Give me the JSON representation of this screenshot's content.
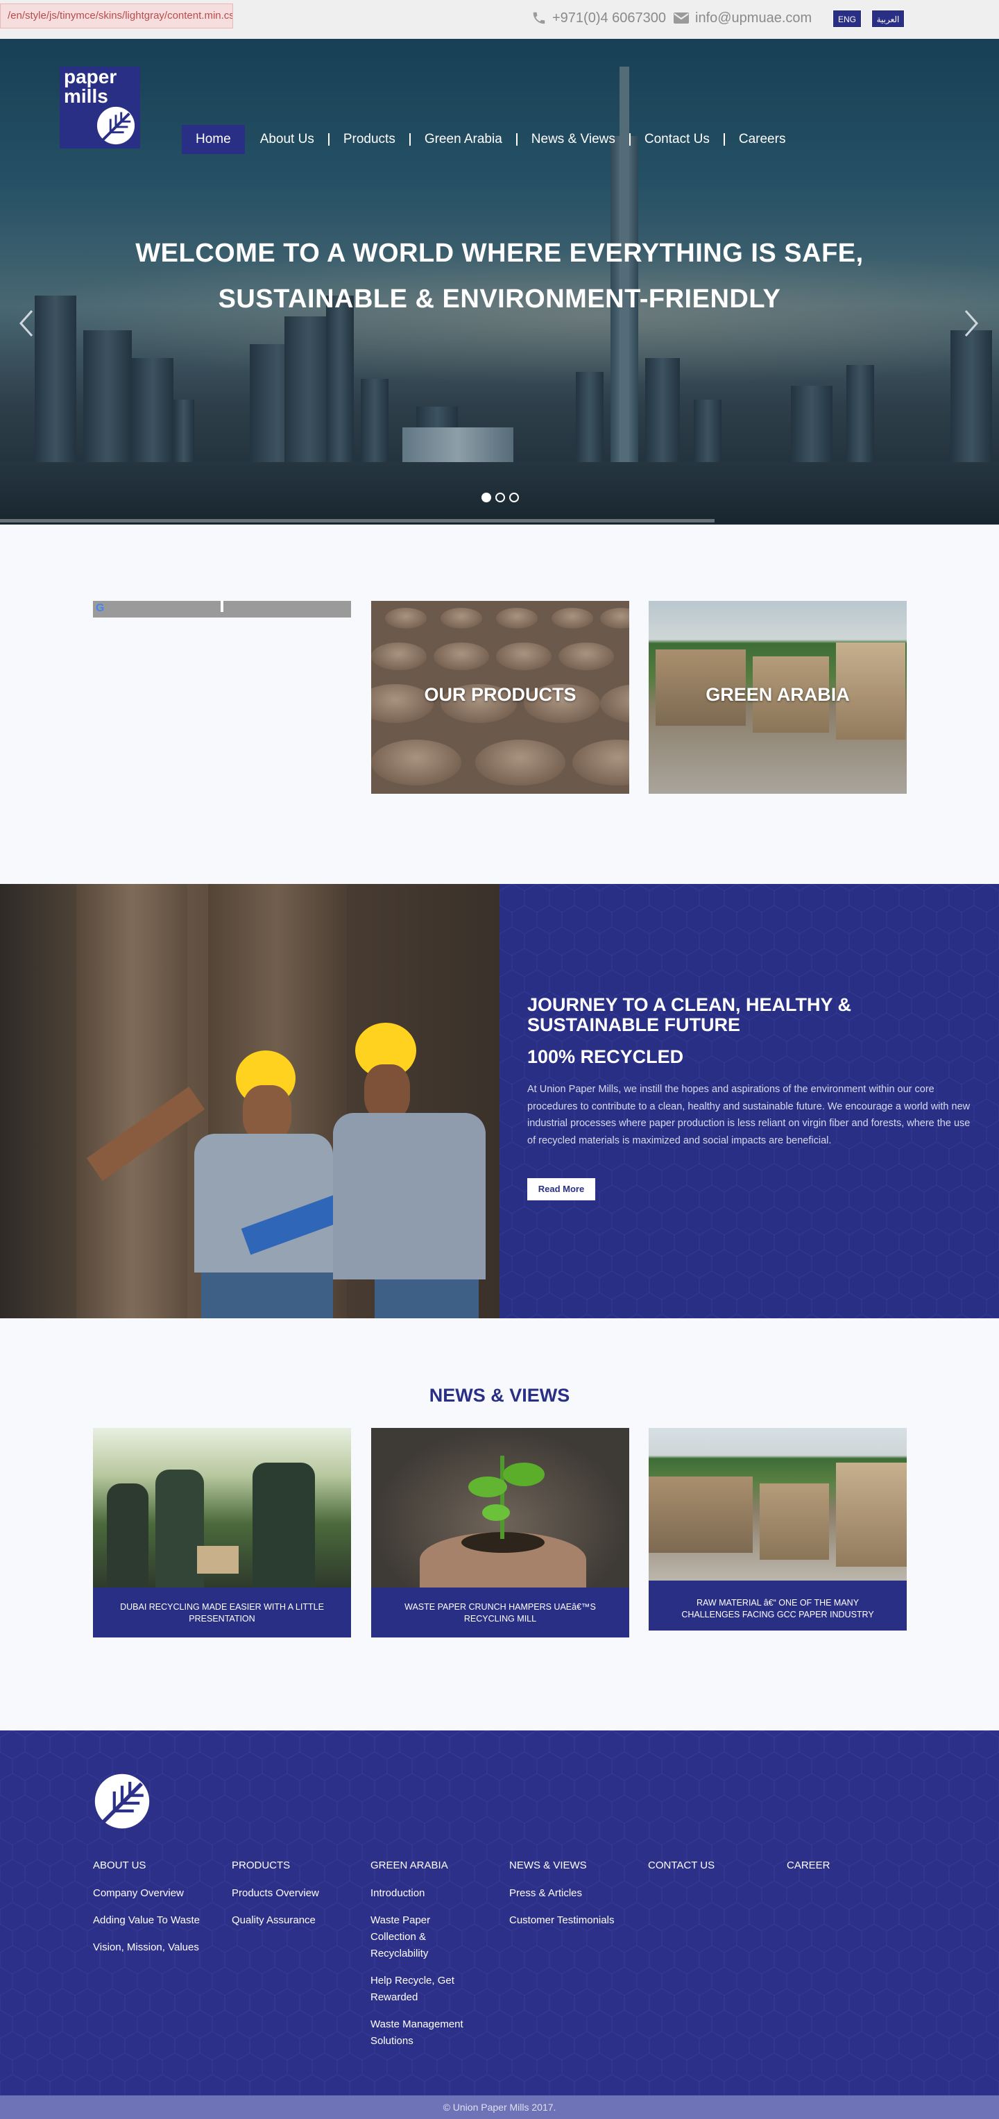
{
  "topbar": {
    "error_note": "/en/style/js/tinymce/skins/lightgray/content.min.css",
    "error_close": "×",
    "phone": "+971(0)4 6067300",
    "email": "info@upmuae.com",
    "lang_en": "ENG",
    "lang_ar": "العربية"
  },
  "logo": {
    "line1": "paper",
    "line2": "mills"
  },
  "nav": {
    "items": [
      {
        "label": "Home",
        "active": true
      },
      {
        "label": "About Us"
      },
      {
        "label": "Products"
      },
      {
        "label": "Green Arabia"
      },
      {
        "label": "News & Views"
      },
      {
        "label": "Contact Us"
      },
      {
        "label": "Careers"
      }
    ]
  },
  "hero": {
    "title_line1": "WELCOME TO A WORLD WHERE EVERYTHING IS SAFE,",
    "title_line2": "SUSTAINABLE & ENVIRONMENT-FRIENDLY",
    "slides_total": 3,
    "slide_active": 1
  },
  "tiles": {
    "google_mark": "G",
    "products_label": "OUR PRODUCTS",
    "green_label": "GREEN ARABIA"
  },
  "journey": {
    "title": "JOURNEY TO A CLEAN, HEALTHY & SUSTAINABLE FUTURE",
    "subtitle": "100% RECYCLED",
    "body": "At Union Paper Mills, we instill the hopes and aspirations of the environment within our core procedures to contribute to a clean, healthy and sustainable future. We encourage a world with new industrial processes where paper production is less reliant on virgin fiber and forests, where the use of recycled materials is maximized and social impacts are beneficial.",
    "button": "Read More"
  },
  "news": {
    "heading": "NEWS & VIEWS",
    "items": [
      {
        "caption": "DUBAI RECYCLING MADE EASIER WITH A LITTLE PRESENTATION"
      },
      {
        "caption": "WASTE PAPER CRUNCH HAMPERS UAEâ€™S RECYCLING MILL"
      },
      {
        "caption": "RAW MATERIAL â€“ ONE OF THE MANY CHALLENGES FACING GCC PAPER INDUSTRY"
      }
    ]
  },
  "footer": {
    "columns": [
      {
        "heading": "ABOUT US",
        "links": [
          "Company Overview",
          "Adding Value To Waste",
          "Vision, Mission, Values"
        ]
      },
      {
        "heading": "PRODUCTS",
        "links": [
          "Products Overview",
          "Quality Assurance"
        ]
      },
      {
        "heading": "GREEN ARABIA",
        "links": [
          "Introduction",
          "Waste Paper Collection & Recyclability",
          "Help Recycle, Get Rewarded",
          "Waste Management Solutions"
        ]
      },
      {
        "heading": "NEWS & VIEWS",
        "links": [
          "Press & Articles",
          "Customer Testimonials"
        ]
      },
      {
        "heading": "CONTACT US",
        "links": []
      },
      {
        "heading": "CAREER",
        "links": []
      }
    ],
    "copyright": "© Union Paper Mills 2017."
  },
  "colors": {
    "brand": "#2a2f86",
    "footer": "#2c3089",
    "copyright_bar": "#6e72b6"
  },
  "icons": [
    "phone-icon",
    "envelope-icon",
    "leaf-logo-icon",
    "chevron-left-icon",
    "chevron-right-icon"
  ]
}
